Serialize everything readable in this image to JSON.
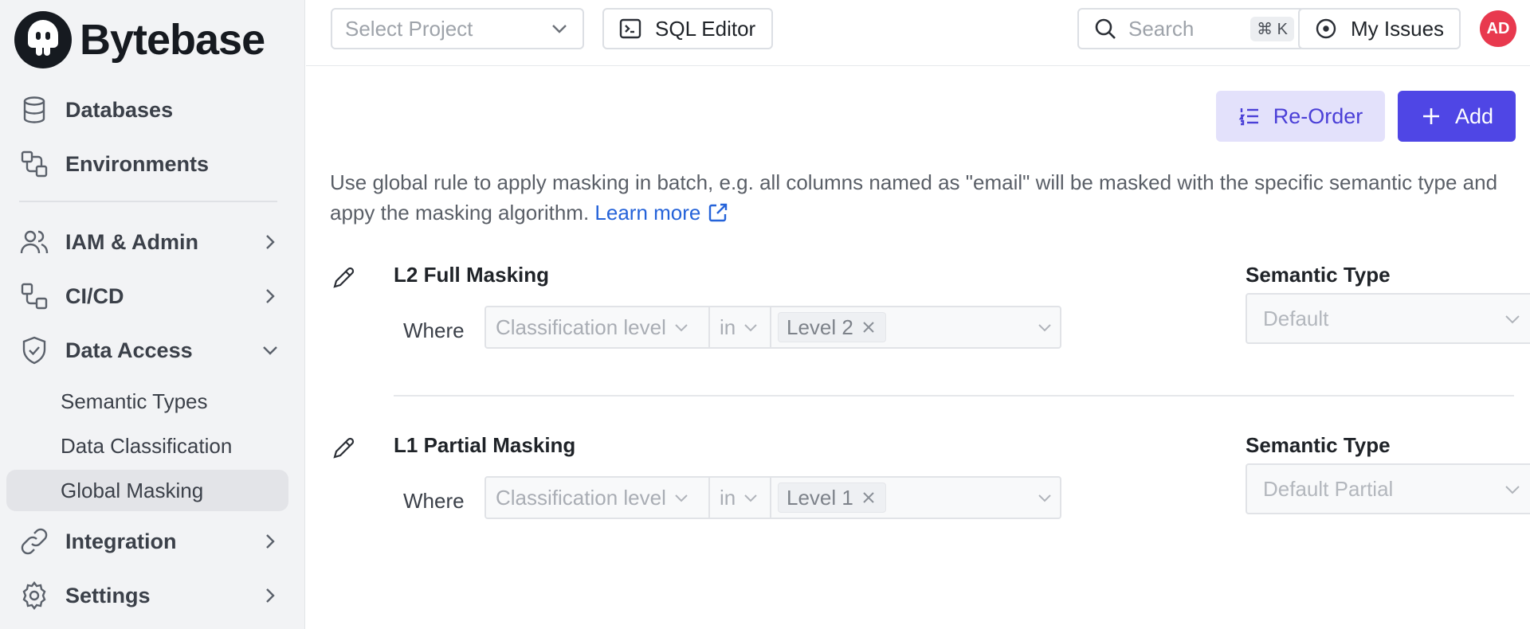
{
  "brand": {
    "name": "Bytebase"
  },
  "sidebar": {
    "items": [
      {
        "label": "Databases",
        "icon": "database-icon"
      },
      {
        "label": "Environments",
        "icon": "environments-icon"
      },
      {
        "label": "IAM & Admin",
        "icon": "users-icon"
      },
      {
        "label": "CI/CD",
        "icon": "cicd-icon"
      },
      {
        "label": "Data Access",
        "icon": "shield-icon"
      },
      {
        "label": "Integration",
        "icon": "link-icon"
      },
      {
        "label": "Settings",
        "icon": "gear-icon"
      }
    ],
    "data_access_children": [
      {
        "label": "Semantic Types"
      },
      {
        "label": "Data Classification"
      },
      {
        "label": "Global Masking",
        "active": true
      }
    ]
  },
  "topbar": {
    "project_placeholder": "Select Project",
    "sql_editor_label": "SQL Editor",
    "search_placeholder": "Search",
    "search_shortcut": "⌘ K",
    "my_issues_label": "My Issues",
    "avatar_initials": "AD"
  },
  "main": {
    "reorder_label": "Re-Order",
    "add_label": "Add",
    "description": "Use global rule to apply masking in batch, e.g. all columns named as \"email\" will be masked with the specific semantic type and appy the masking algorithm.",
    "learn_more": "Learn more",
    "rules": [
      {
        "title": "L2 Full Masking",
        "where_label": "Where",
        "field": "Classification level",
        "operator": "in",
        "value": "Level 2",
        "semantic_type_label": "Semantic Type",
        "semantic_type": "Default"
      },
      {
        "title": "L1 Partial Masking",
        "where_label": "Where",
        "field": "Classification level",
        "operator": "in",
        "value": "Level 1",
        "semantic_type_label": "Semantic Type",
        "semantic_type": "Default Partial"
      }
    ]
  },
  "colors": {
    "primary": "#4f46e5",
    "primary_light": "#e3e1fb",
    "link": "#2563d9",
    "avatar": "#e8394e",
    "sidebar_bg": "#f2f3f5"
  }
}
